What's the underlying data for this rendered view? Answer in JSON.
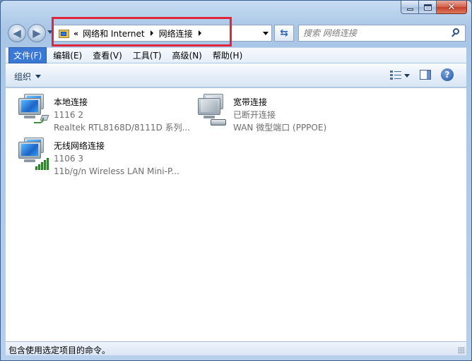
{
  "window": {
    "caption": {
      "minimize": "minimize-glyph",
      "maximize": "maximize-glyph",
      "close": "✕"
    }
  },
  "nav": {
    "back_glyph": "◀",
    "forward_glyph": "▶",
    "address": {
      "overflow": "«",
      "crumbs": [
        "网络和 Internet",
        "网络连接"
      ]
    },
    "refresh_glyph": "⇆",
    "search": {
      "placeholder": "搜索 网络连接"
    }
  },
  "menubar": {
    "items": [
      "文件(F)",
      "编辑(E)",
      "查看(V)",
      "工具(T)",
      "高级(N)",
      "帮助(H)"
    ],
    "active_index": 0
  },
  "cmdbar": {
    "organize": "组织",
    "help": "?"
  },
  "connections": [
    {
      "name": "本地连接",
      "line2": "1116  2",
      "line3": "Realtek RTL8168D/8111D 系列...",
      "icon": "wired-network-icon"
    },
    {
      "name": "宽带连接",
      "line2": "已断开连接",
      "line3": "WAN 微型端口 (PPPOE)",
      "icon": "broadband-network-icon"
    },
    {
      "name": "无线网络连接",
      "line2": "1106  3",
      "line3": "11b/g/n  Wireless LAN Mini-P...",
      "icon": "wireless-network-icon"
    }
  ],
  "statusbar": {
    "text": "包含使用选定项目的命令。"
  },
  "colors": {
    "highlight_box": "#e1263a",
    "menu_active": "#3a78d6",
    "secondary_text": "#6d6d6d"
  }
}
